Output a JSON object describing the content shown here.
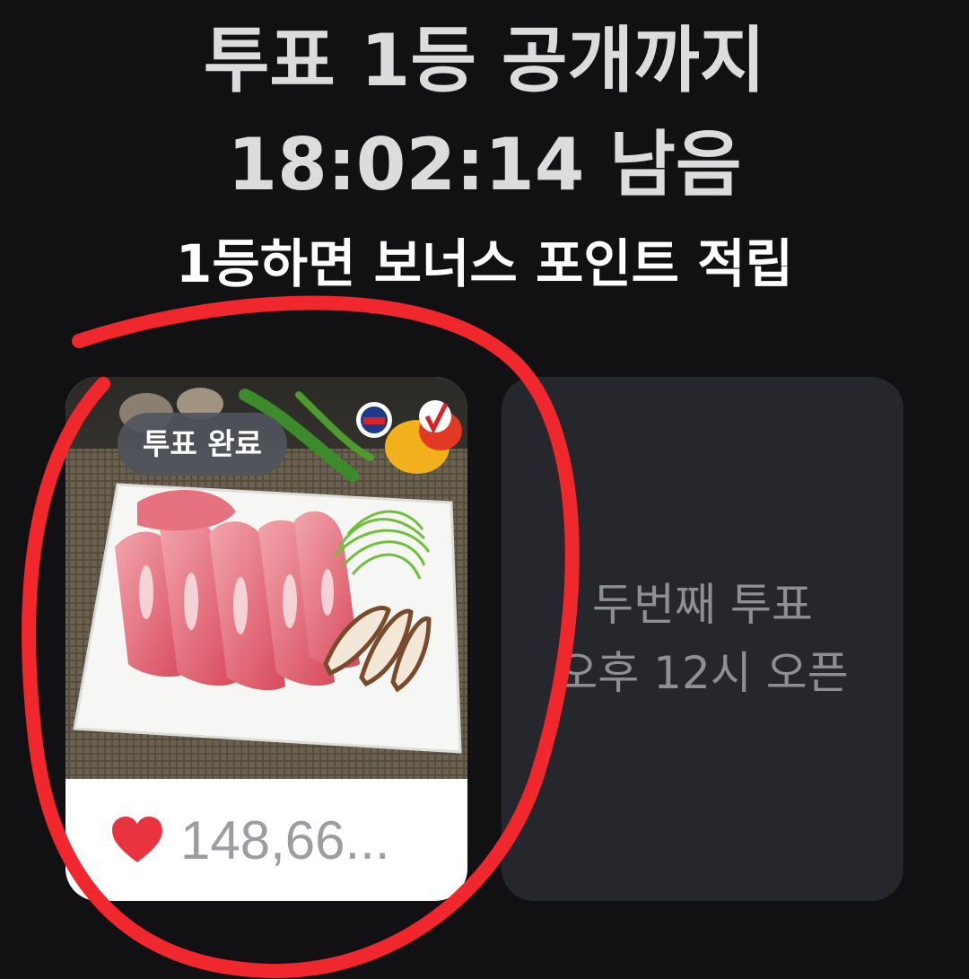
{
  "header": {
    "title_line1": "투표 1등 공개까지",
    "countdown": "18:02:14 남음",
    "bonus": "1등하면 보너스 포인트 적립"
  },
  "cards": {
    "voted": {
      "badge": "투표 완료",
      "vote_count": "148,66...",
      "heart_icon": "heart-icon"
    },
    "next": {
      "line1": "두번째 투표",
      "line2": "오후 12시 오픈"
    }
  },
  "colors": {
    "background": "#111114",
    "heart": "#e8343f",
    "marker": "#f0282d",
    "next_card": "#26272c"
  }
}
